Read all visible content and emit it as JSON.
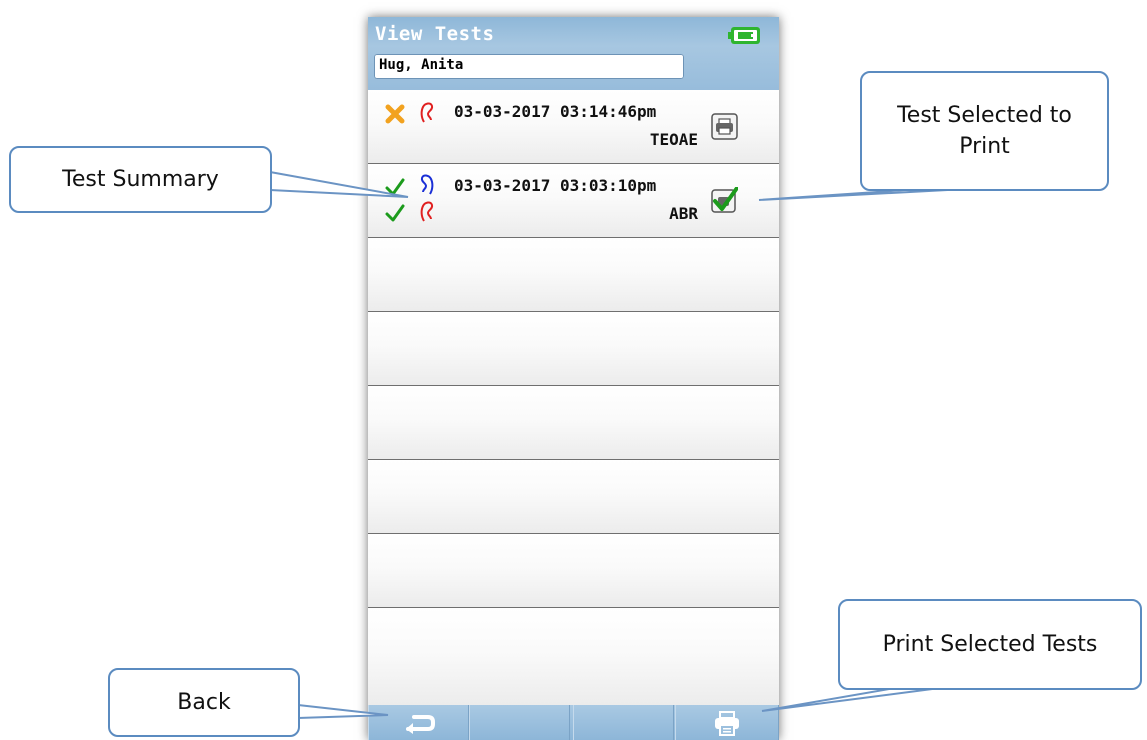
{
  "app": {
    "title": "View Tests",
    "battery_icon": "battery-charging-icon"
  },
  "patient": {
    "name": "Hug, Anita"
  },
  "tests": [
    {
      "date": "03-03-2017 03:14:46pm",
      "type": "TEOAE",
      "results": [
        {
          "status": "fail",
          "ear": "left"
        }
      ],
      "print_selected": false
    },
    {
      "date": "03-03-2017 03:03:10pm",
      "type": "ABR",
      "results": [
        {
          "status": "pass",
          "ear": "right"
        },
        {
          "status": "pass",
          "ear": "left"
        }
      ],
      "print_selected": true
    }
  ],
  "empty_rows": 6,
  "bottom_bar": {
    "back_icon": "return-arrow-icon",
    "print_icon": "printer-icon"
  },
  "callouts": {
    "test_summary": "Test Summary",
    "test_selected": "Test Selected to Print",
    "print_selected": "Print Selected Tests",
    "back": "Back"
  },
  "colors": {
    "pass": "#1c9b1c",
    "fail": "#f2a21f",
    "right_ear": "#1a2fd6",
    "left_ear": "#e02020",
    "callout_border": "#5b8bc0",
    "header": "#9fc2df"
  }
}
